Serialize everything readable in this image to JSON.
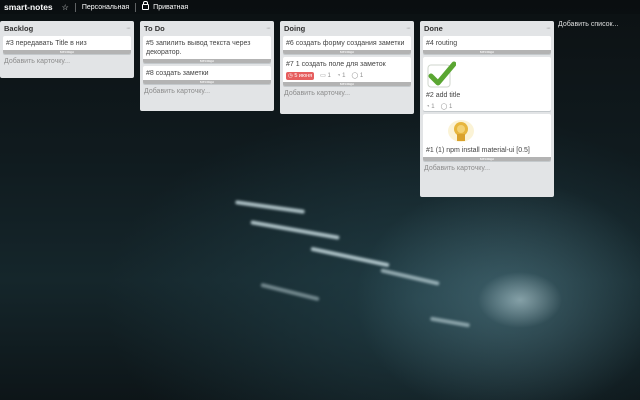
{
  "topbar": {
    "title": "smart-notes",
    "org": "Персональная",
    "visibility": "Приватная"
  },
  "labels": {
    "add_card": "Добавить карточку...",
    "add_list": "Добавить список...",
    "card_bar": "месяцы"
  },
  "lists": [
    {
      "title": "Backlog",
      "cards": [
        {
          "title": "#3 передавать Title в низ"
        }
      ]
    },
    {
      "title": "To Do",
      "cards": [
        {
          "title": "#5 запилить вывод текста через декоратор."
        },
        {
          "title": "#8 создать заметки"
        }
      ]
    },
    {
      "title": "Doing",
      "cards": [
        {
          "title": "#6 создать форму создания заметки"
        },
        {
          "title": "#7 1 создать поле для заметок",
          "due": "5 июня",
          "watch": "1",
          "checklist": "1",
          "comments": "1"
        }
      ]
    },
    {
      "title": "Done",
      "cards": [
        {
          "title": "#4 routing"
        },
        {
          "title": "#2 add title",
          "checklist": "1",
          "comments": "1"
        },
        {
          "title": "#1 (1) npm install material-ui [0.5]"
        }
      ]
    }
  ],
  "colors": {
    "list_bg": "#e2e4e6",
    "due": "#e65e5e",
    "check": "#5aa632",
    "badge": "#e7b63d"
  }
}
